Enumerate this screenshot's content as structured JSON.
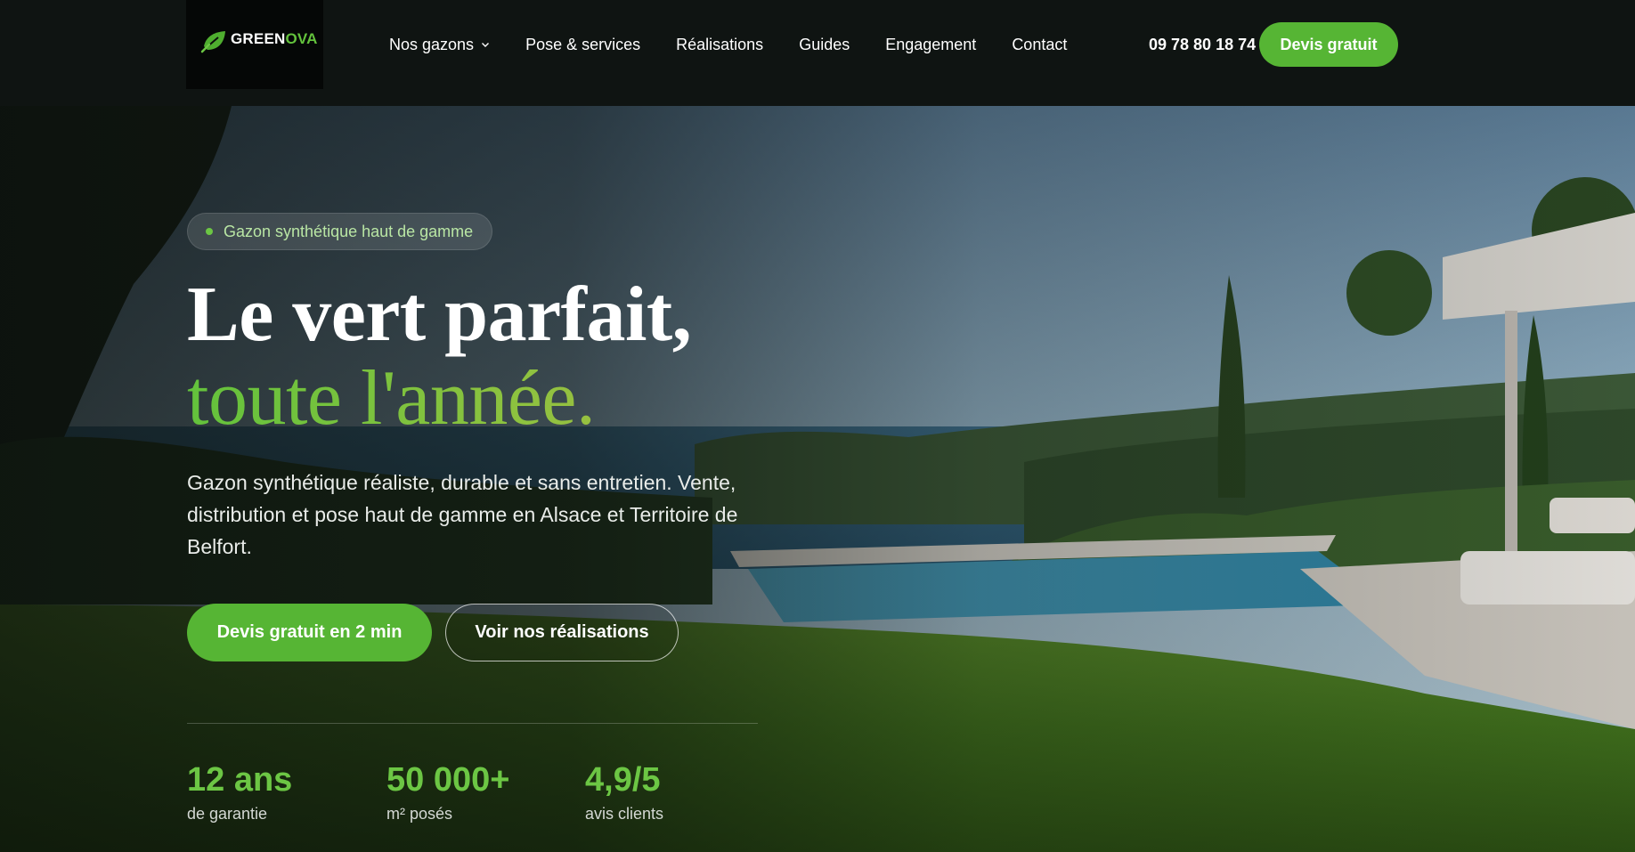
{
  "colors": {
    "accent": "#56b534",
    "accent_light": "#6cc644",
    "gold": "#c6b548",
    "header_bg": "#0f1412"
  },
  "header": {
    "logo": {
      "brand_prefix": "GREEN",
      "brand_suffix": "OVA",
      "icon": "leaf-logo-icon"
    },
    "nav": [
      {
        "label": "Nos gazons",
        "has_dropdown": true,
        "icon": "chevron-down-icon"
      },
      {
        "label": "Pose & services"
      },
      {
        "label": "Réalisations"
      },
      {
        "label": "Guides"
      },
      {
        "label": "Engagement"
      },
      {
        "label": "Contact"
      }
    ],
    "phone": "09 78 80 18 74",
    "cta_label": "Devis gratuit"
  },
  "hero": {
    "badge": "Gazon synthétique haut de gamme",
    "title_line1": "Le vert parfait,",
    "title_line2": "toute l'année.",
    "lead": "Gazon synthétique réaliste, durable et sans entretien. Vente, distribution et pose haut de gamme en Alsace et Territoire de Belfort.",
    "primary_cta": "Devis gratuit en 2 min",
    "secondary_cta": "Voir nos réalisations",
    "stats": [
      {
        "value": "12 ans",
        "label": "de garantie"
      },
      {
        "value": "50 000+",
        "label": "m² posés"
      },
      {
        "value": "4,9/5",
        "label": "avis clients"
      }
    ]
  }
}
